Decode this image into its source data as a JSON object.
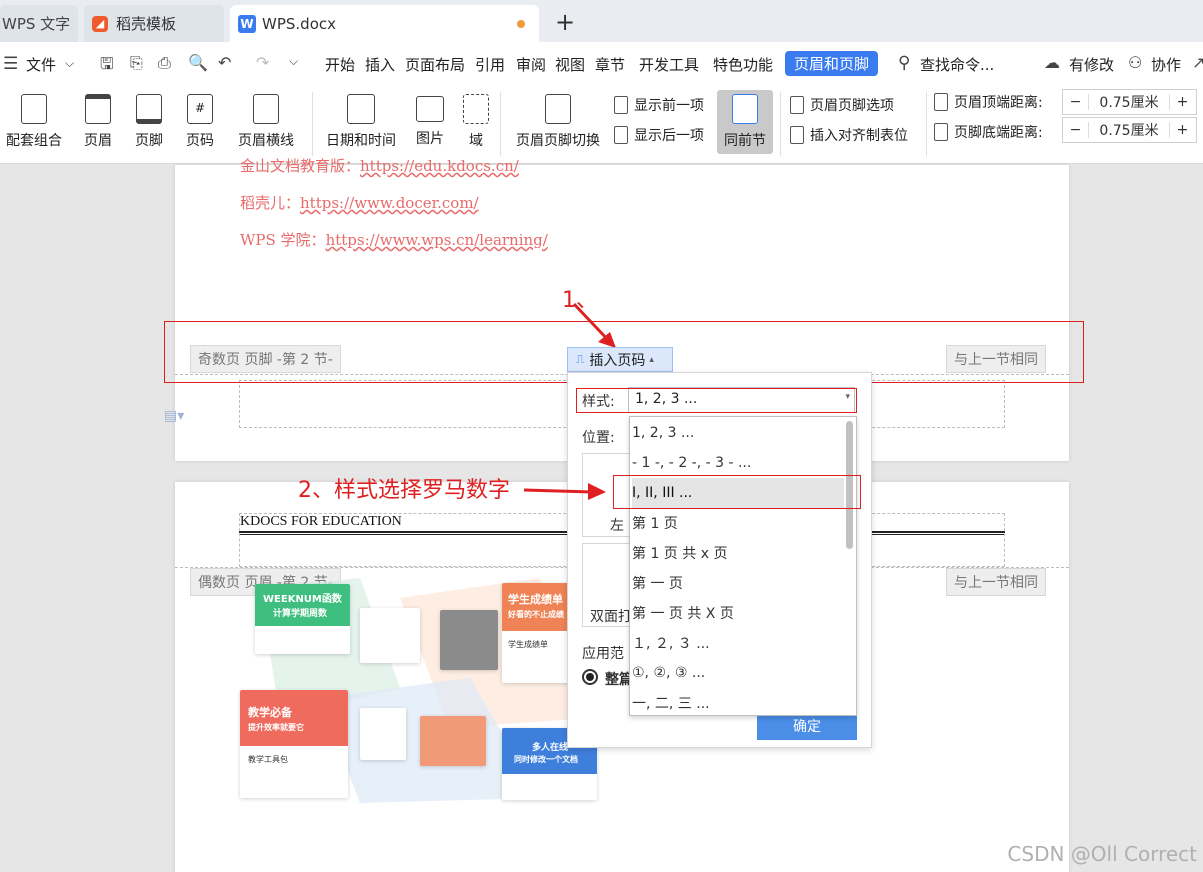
{
  "tabs": [
    {
      "label": "WPS 文字"
    },
    {
      "label": "稻壳模板",
      "icon": "docer-logo-icon"
    },
    {
      "label": "WPS.docx",
      "icon": "wps-w-icon"
    }
  ],
  "menu": {
    "file": "文件",
    "items": [
      "开始",
      "插入",
      "页面布局",
      "引用",
      "审阅",
      "视图",
      "章节",
      "开发工具",
      "特色功能"
    ],
    "active": "页眉和页脚",
    "search": "查找命令...",
    "modified": "有修改",
    "collab": "协作"
  },
  "ribbon": {
    "btns": [
      "配套组合",
      "页眉",
      "页脚",
      "页码",
      "页眉横线",
      "日期和时间",
      "图片",
      "域",
      "页眉页脚切换",
      "同前节"
    ],
    "show_prev": "显示前一项",
    "show_next": "显示后一项",
    "hf_options": "页眉页脚选项",
    "insert_align_tab": "插入对齐制表位",
    "header_top_label": "页眉顶端距离:",
    "header_top_value": "0.75厘米",
    "footer_bottom_label": "页脚底端距离:",
    "footer_bottom_value": "0.75厘米"
  },
  "page1": {
    "line1_label": "金山文档教育版：",
    "line1_url": "https://edu.kdocs.cn/",
    "line2_label": "稻壳儿：",
    "line2_url": "https://www.docer.com/",
    "line3_label": "WPS 学院：",
    "line3_url": "https://www.wps.cn/learning/",
    "footer_badge": "奇数页 页脚 -第 2 节-",
    "same_as_prev": "与上一节相同"
  },
  "page2": {
    "header_text": "KDOCS FOR EDUCATION",
    "header_badge": "偶数页 页眉 -第 2 节-",
    "same_as_prev": "与上一节相同",
    "cards": {
      "weeknum_title": "WEEKNUM函数",
      "weeknum_sub": "计算学期周数",
      "grade_title": "学生成绩单",
      "grade_sub": "好看的不止成绩",
      "grade_caption": "学生成绩单",
      "teach_title": "教学必备",
      "teach_sub": "提升效率就要它",
      "teach_caption": "教学工具包",
      "online_title": "多人在线",
      "online_sub": "同时修改一个文档"
    }
  },
  "popup": {
    "button": "插入页码",
    "style_label": "样式:",
    "style_value": "1, 2, 3 ...",
    "position_label": "位置:",
    "left_partial": "左",
    "duplex_partial": "双面打",
    "apply_partial": "应用范",
    "whole_partial": "整篇",
    "ok": "确定",
    "options": [
      "1, 2, 3 ...",
      "- 1 -, - 2 -, - 3 - ...",
      "I, II, III ...",
      "第 1 页",
      "第 1 页 共 x 页",
      "第 一 页",
      "第 一 页 共 X 页",
      "１, ２, ３ ...",
      "①, ②, ③ ...",
      "一, 二, 三 ..."
    ],
    "selected_index": 2
  },
  "annotations": {
    "step1": "1、",
    "step2": "2、样式选择罗马数字"
  },
  "watermark": "CSDN @Oll Correct",
  "colors": {
    "accent": "#3b7bf0",
    "annotation_red": "#e02020",
    "link_red": "#e86a6a"
  }
}
